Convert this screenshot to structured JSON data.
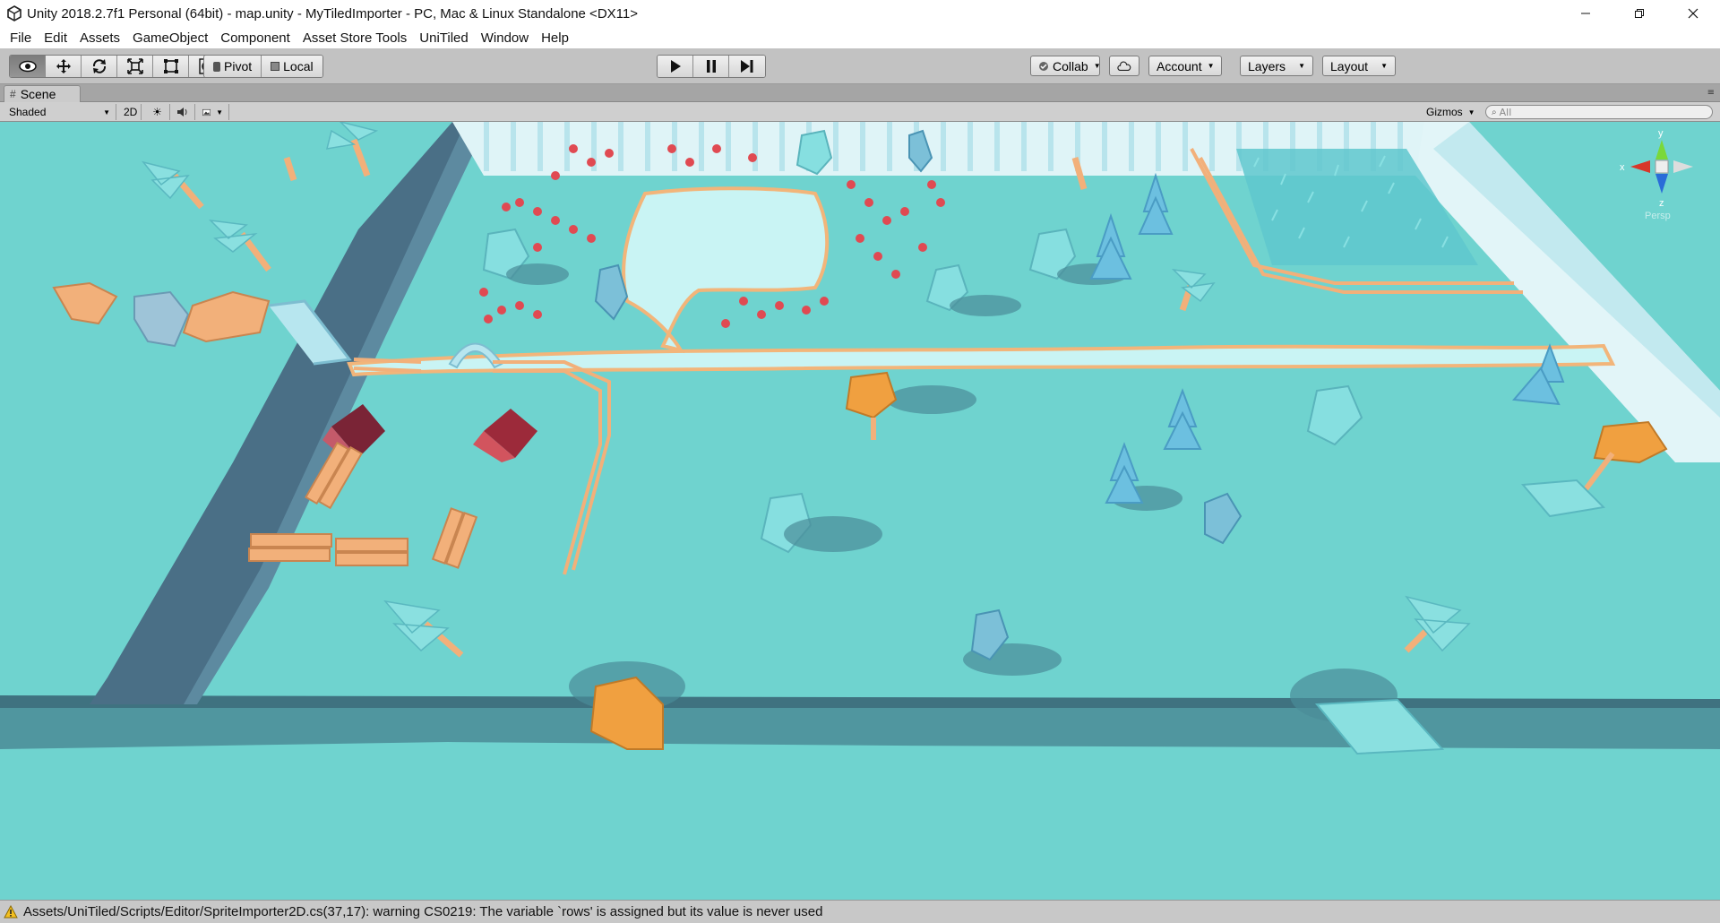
{
  "window": {
    "title": "Unity 2018.2.7f1 Personal (64bit) - map.unity - MyTiledImporter - PC, Mac & Linux Standalone <DX11>",
    "minimize_icon": "minimize-icon",
    "maximize_icon": "restore-icon",
    "close_icon": "close-icon"
  },
  "menu": {
    "items": [
      "File",
      "Edit",
      "Assets",
      "GameObject",
      "Component",
      "Asset Store Tools",
      "UniTiled",
      "Window",
      "Help"
    ]
  },
  "toolbar": {
    "transform_tools": [
      "view-tool",
      "move-tool",
      "rotate-tool",
      "scale-tool",
      "rect-tool",
      "transform-tool"
    ],
    "pivot_label": "Pivot",
    "local_label": "Local",
    "collab_label": "Collab",
    "account_label": "Account",
    "layers_label": "Layers",
    "layout_label": "Layout"
  },
  "scene_tab": {
    "label": "Scene"
  },
  "scene_toolbar": {
    "shading_mode": "Shaded",
    "mode_2d": "2D",
    "gizmos_label": "Gizmos",
    "search_placeholder": "All"
  },
  "scene_gizmo": {
    "axis_x": "x",
    "axis_y": "y",
    "axis_z": "z",
    "projection": "Persp"
  },
  "status": {
    "message": "Assets/UniTiled/Scripts/Editor/SpriteImporter2D.cs(37,17): warning CS0219: The variable `rows' is assigned but its value is never used"
  },
  "colors": {
    "ground": "#6fd3cf",
    "cliff_shadow": "#4a6f86",
    "fence_wall": "#d7f0f4",
    "water": "#c9f4f4",
    "shore": "#f2b57a",
    "flower": "#e04a52",
    "house_roof": "#9c2a3a",
    "wood": "#f2b07a",
    "orange_tree": "#f0a040",
    "warning": "#f4c020"
  }
}
